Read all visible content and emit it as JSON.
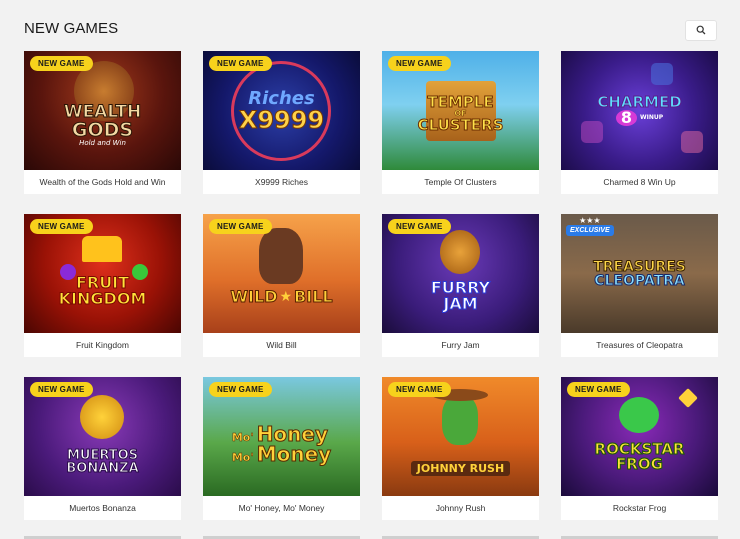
{
  "header": {
    "title": "NEW GAMES"
  },
  "icons": {
    "search": "search-icon"
  },
  "badge_new": "NEW GAME",
  "badge_exclusive": "EXCLUSIVE",
  "games": [
    {
      "name": "Wealth of the Gods Hold and Win",
      "logo_top": "WEALTH",
      "logo_mid": "GODS",
      "logo_sub": "Hold and Win"
    },
    {
      "name": "X9999 Riches",
      "logo_top": "Riches",
      "logo_mid": "X9999"
    },
    {
      "name": "Temple Of Clusters",
      "logo_top": "TEMPLE",
      "logo_of": "OF",
      "logo_mid": "CLUSTERS"
    },
    {
      "name": "Charmed 8 Win Up",
      "logo_top": "CHARMED",
      "logo_mid": "8",
      "logo_sub": "WINUP"
    },
    {
      "name": "Fruit Kingdom",
      "logo_top": "FRUIT",
      "logo_mid": "KINGDOM"
    },
    {
      "name": "Wild Bill",
      "logo_top": "WILD",
      "logo_mid": "BILL"
    },
    {
      "name": "Furry Jam",
      "logo_top": "FURRY",
      "logo_mid": "JAM"
    },
    {
      "name": "Treasures of Cleopatra",
      "logo_top": "TREASURES",
      "logo_mid": "CLEOPATRA"
    },
    {
      "name": "Muertos Bonanza",
      "logo_top": "MUERTOS",
      "logo_mid": "BONANZA"
    },
    {
      "name": "Mo' Honey, Mo' Money",
      "logo_top": "Honey",
      "logo_mid": "Money",
      "logo_pre": "Mo'",
      "logo_pre2": "Mo'"
    },
    {
      "name": "Johnny Rush",
      "logo_top": "JOHNNY RUSH"
    },
    {
      "name": "Rockstar Frog",
      "logo_top": "ROCKSTAR",
      "logo_mid": "FROG"
    }
  ],
  "colors": {
    "badge": "#f7d21c",
    "exclusive": "#2a7be8",
    "background": "#f2f2f2"
  }
}
